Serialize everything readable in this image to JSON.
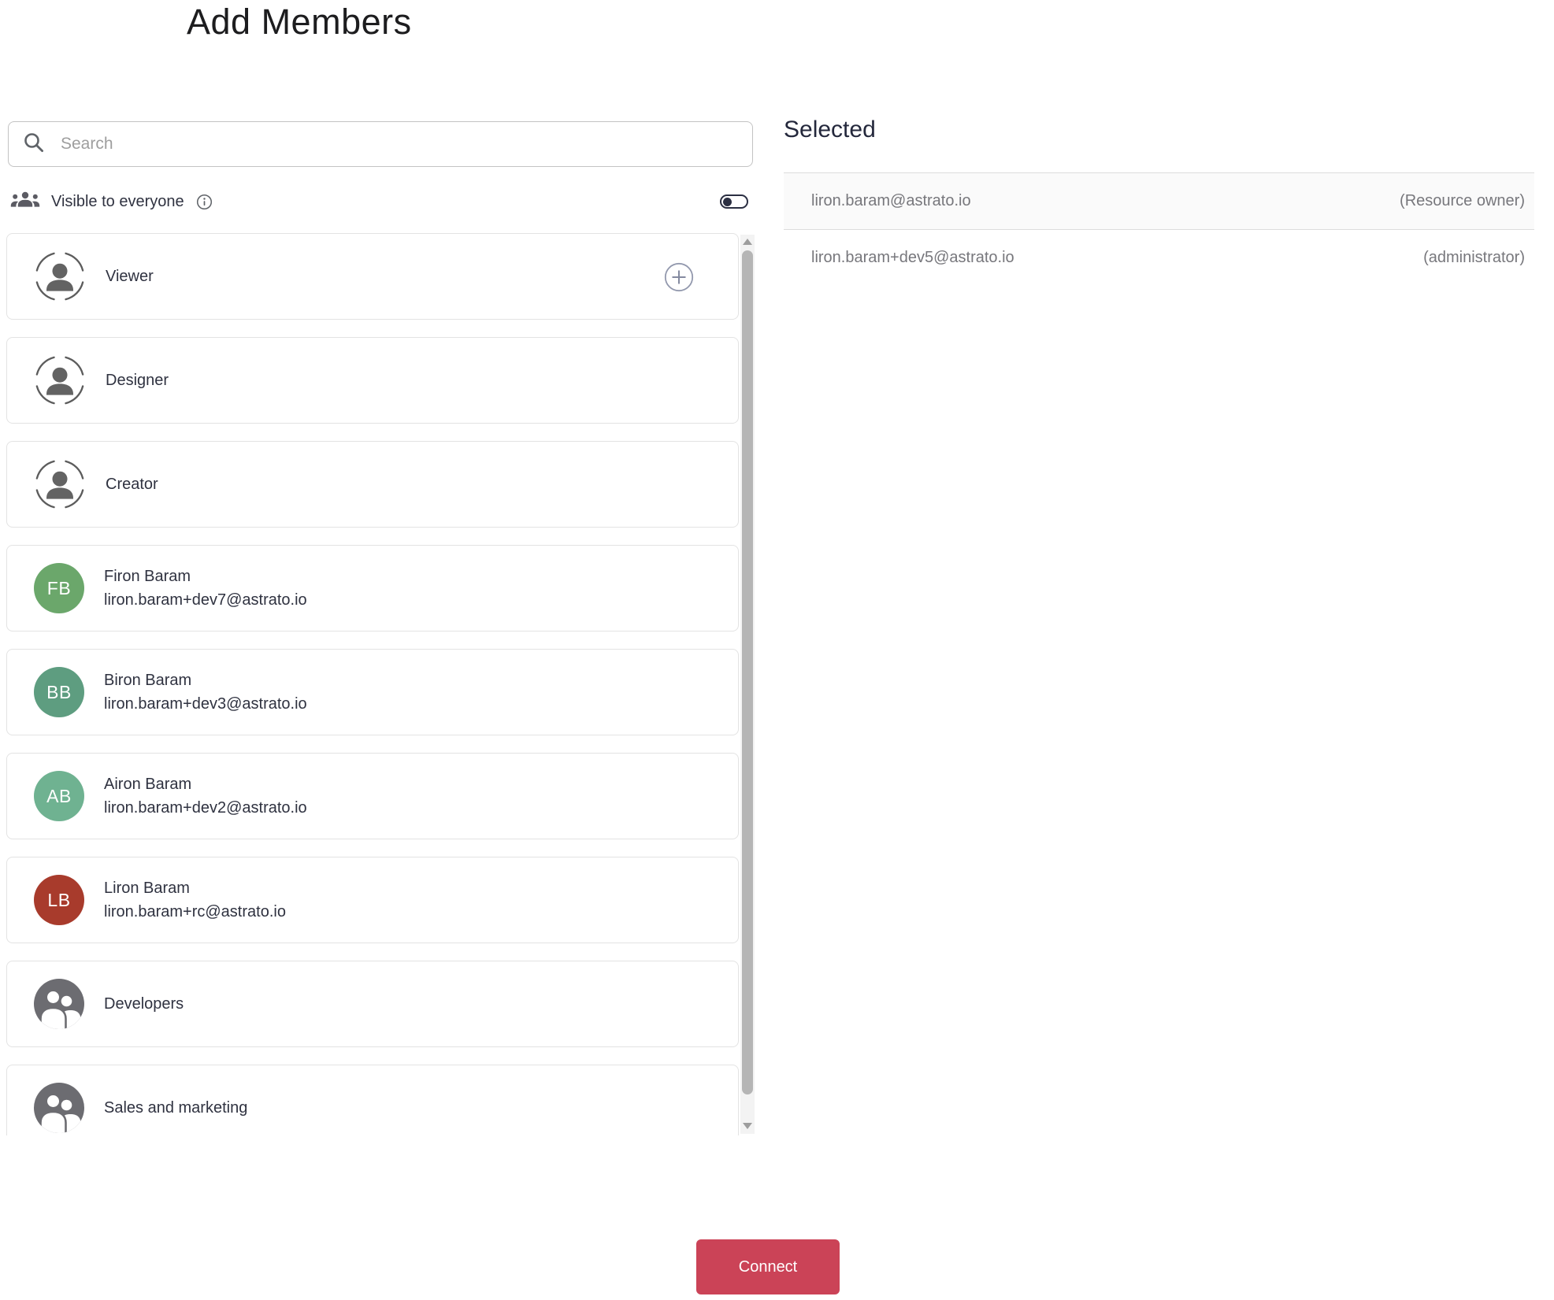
{
  "title": "Add Members",
  "search": {
    "placeholder": "Search"
  },
  "visibility": {
    "label": "Visible to everyone",
    "toggle_state": "off"
  },
  "icons": {
    "search": "magnifier",
    "visibility": "people-group",
    "info": "info-circle",
    "role": "person-in-dashed-circle",
    "group": "two-people",
    "add": "plus-circle",
    "scroll_up": "triangle-up",
    "scroll_down": "triangle-down"
  },
  "list": {
    "items": [
      {
        "type": "role",
        "label": "Viewer",
        "has_add_button": true
      },
      {
        "type": "role",
        "label": "Designer"
      },
      {
        "type": "role",
        "label": "Creator"
      },
      {
        "type": "user",
        "name": "Firon Baram",
        "email": "liron.baram+dev7@astrato.io",
        "initials": "FB",
        "color": "#6BA76B"
      },
      {
        "type": "user",
        "name": "Biron Baram",
        "email": "liron.baram+dev3@astrato.io",
        "initials": "BB",
        "color": "#5E9D80"
      },
      {
        "type": "user",
        "name": "Airon Baram",
        "email": "liron.baram+dev2@astrato.io",
        "initials": "AB",
        "color": "#6FB291"
      },
      {
        "type": "user",
        "name": "Liron Baram",
        "email": "liron.baram+rc@astrato.io",
        "initials": "LB",
        "color": "#A83B2C"
      },
      {
        "type": "group",
        "label": "Developers"
      },
      {
        "type": "group",
        "label": "Sales and marketing"
      }
    ]
  },
  "selected": {
    "heading": "Selected",
    "rows": [
      {
        "email": "liron.baram@astrato.io",
        "role": "(Resource owner)"
      },
      {
        "email": "liron.baram+dev5@astrato.io",
        "role": "(administrator)"
      }
    ]
  },
  "footer": {
    "connect_label": "Connect"
  },
  "colors": {
    "accent": "#CB4357",
    "toggle": "#2B2F42",
    "group_avatar": "#6C6C71"
  }
}
